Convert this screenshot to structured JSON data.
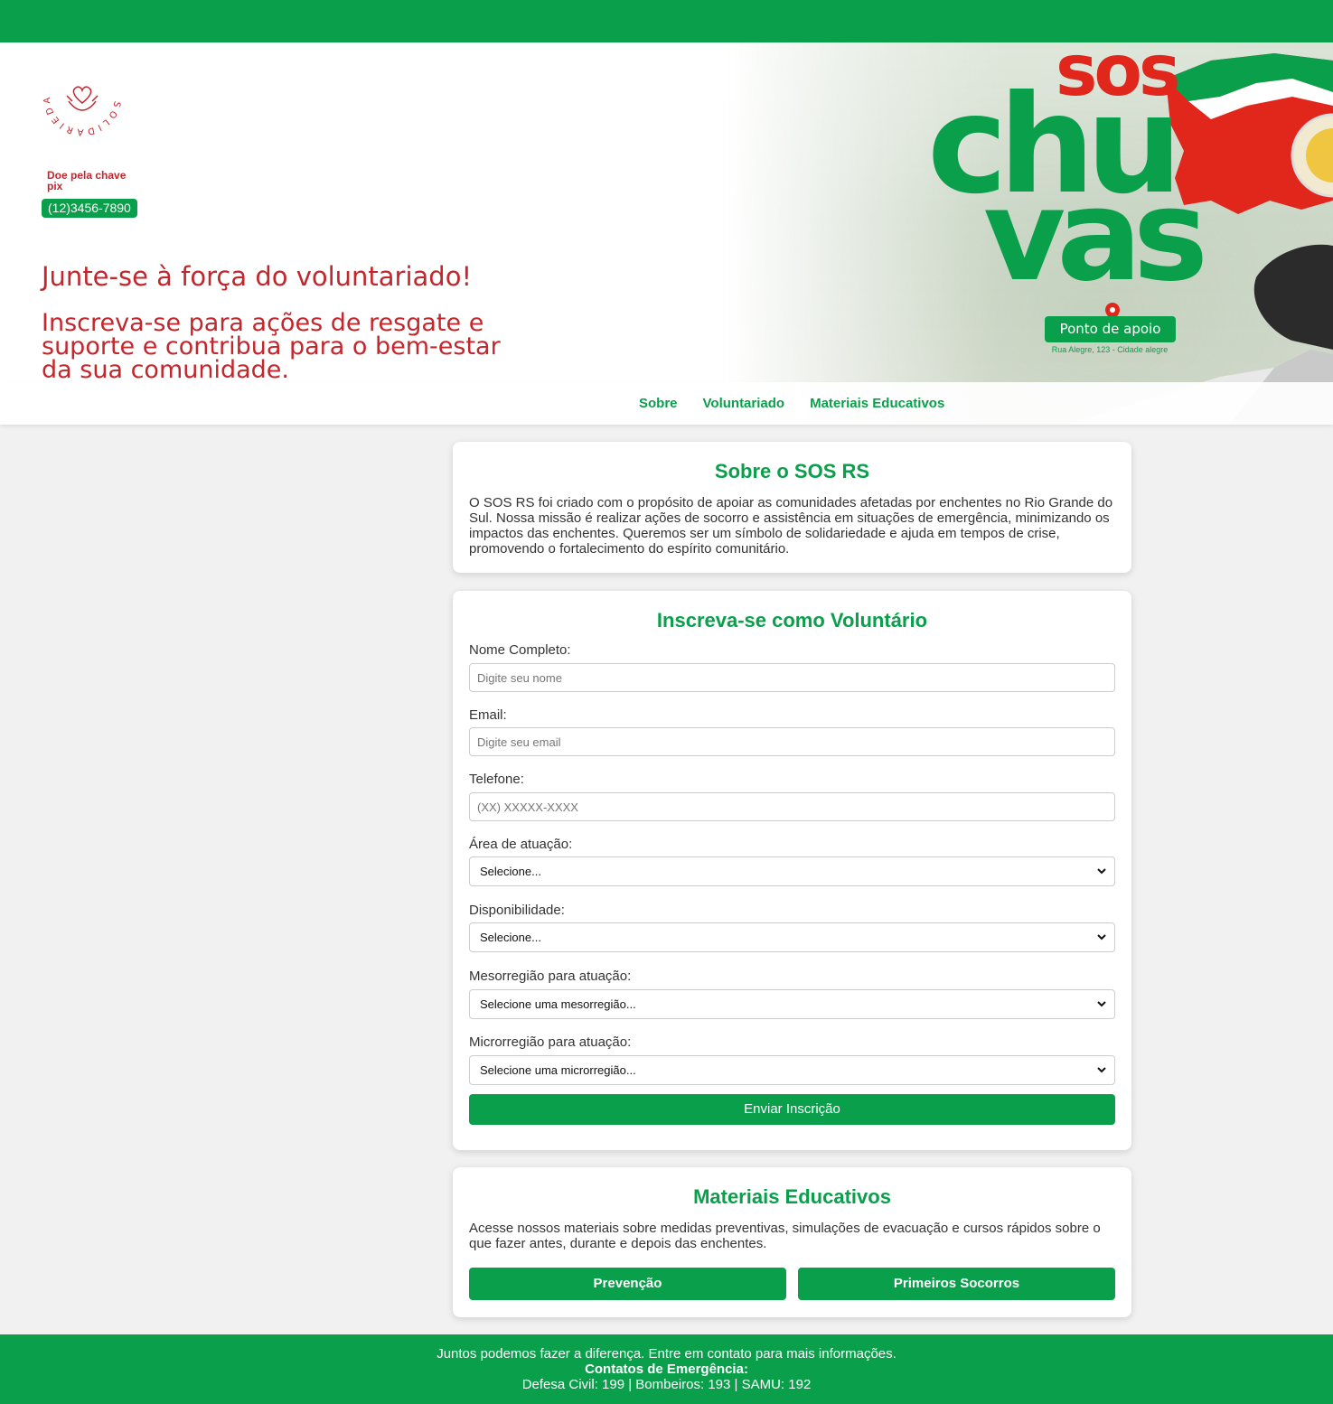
{
  "hero": {
    "logo_text": "SOLIDARIEDADE",
    "pix_label": "Doe pela chave pix",
    "pix_number": "(12)3456-7890",
    "headline": "Junte-se à força do voluntariado!",
    "subheadline": "Inscreva-se para ações de resgate e suporte e contribua para o bem-estar da sua comunidade.",
    "art_title_sos": "sos",
    "art_title_chu": "chu",
    "art_title_vas": "vas",
    "ponto_label": "Ponto de apoio",
    "address": "Rua Alegre, 123 - Cidade alegre"
  },
  "nav": {
    "items": [
      {
        "label": "Sobre"
      },
      {
        "label": "Voluntariado"
      },
      {
        "label": "Materiais Educativos"
      }
    ]
  },
  "about": {
    "title": "Sobre o SOS RS",
    "text": "O SOS RS foi criado com o propósito de apoiar as comunidades afetadas por enchentes no Rio Grande do Sul. Nossa missão é realizar ações de socorro e assistência em situações de emergência, minimizando os impactos das enchentes. Queremos ser um símbolo de solidariedade e ajuda em tempos de crise, promovendo o fortalecimento do espírito comunitário."
  },
  "form": {
    "title": "Inscreva-se como Voluntário",
    "name_label": "Nome Completo:",
    "name_placeholder": "Digite seu nome",
    "email_label": "Email:",
    "email_placeholder": "Digite seu email",
    "phone_label": "Telefone:",
    "phone_placeholder": "(XX) XXXXX-XXXX",
    "area_label": "Área de atuação:",
    "area_value": "Selecione...",
    "availability_label": "Disponibilidade:",
    "availability_value": "Selecione...",
    "meso_label": "Mesorregião para atuação:",
    "meso_value": "Selecione uma mesorregião...",
    "micro_label": "Microrregião para atuação:",
    "micro_value": "Selecione uma microrregião...",
    "submit_label": "Enviar Inscrição"
  },
  "materials": {
    "title": "Materiais Educativos",
    "text": "Acesse nossos materiais sobre medidas preventivas, simulações de evacuação e cursos rápidos sobre o que fazer antes, durante e depois das enchentes.",
    "btn_prevention": "Prevenção",
    "btn_first_aid": "Primeiros Socorros"
  },
  "footer": {
    "line1": "Juntos podemos fazer a diferença. Entre em contato para mais informações.",
    "line2": "Contatos de Emergência:",
    "line3": "Defesa Civil: 199 | Bombeiros: 193 | SAMU: 192"
  },
  "colors": {
    "brand_green": "#0a9f4b",
    "brand_red": "#c2272d",
    "page_bg": "#f1f1f1"
  }
}
